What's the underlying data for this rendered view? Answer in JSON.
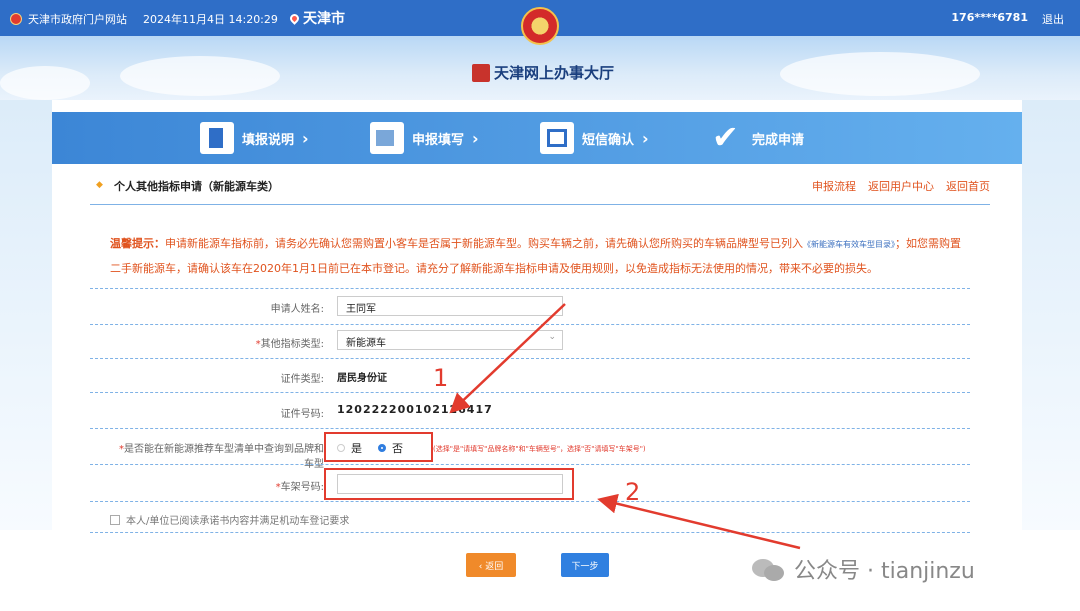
{
  "topbar": {
    "portal": "天津市政府门户网站",
    "datetime": "2024年11月4日 14:20:29",
    "city": "天津市",
    "phone": "176****6781",
    "logout": "退出"
  },
  "banner": {
    "title": "天津网上办事大厅"
  },
  "steps": [
    {
      "label": "填报说明",
      "icon": "doc-icon"
    },
    {
      "label": "申报填写",
      "icon": "pen-icon"
    },
    {
      "label": "短信确认",
      "icon": "phone-icon"
    },
    {
      "label": "完成申请",
      "icon": "check-icon"
    }
  ],
  "page": {
    "title": "个人其他指标申请（新能源车类）",
    "links": [
      "申报流程",
      "返回用户中心",
      "返回首页"
    ]
  },
  "notice": {
    "label": "温馨提示：",
    "text1": "申请新能源车指标前，请务必先确认您需购置小客车是否属于新能源车型。购买车辆之前，请先确认您所购买的车辆品牌型号已列入",
    "link": "《新能源车有效车型目录》",
    "text2": "；如您需购置二手新能源车，请确认该车在2020年1月1日前已在本市登记。请充分了解新能源车指标申请及使用规则，以免造成指标无法使用的情况，带来不必要的损失。"
  },
  "form": {
    "name_label": "申请人姓名:",
    "name_value": "王同军",
    "type_label": "其他指标类型:",
    "type_value": "新能源车",
    "id_type_label": "证件类型:",
    "id_type_value": "居民身份证",
    "id_no_label": "证件号码:",
    "id_no_value": "120222200102126417",
    "query_label": "是否能在新能源推荐车型清单中查询到品牌和车型",
    "radio_yes": "是",
    "radio_no": "否",
    "radio_selected": "否",
    "hint": "(选择\"是\"请填写\"品牌名称\"和\"车辆型号\"，选择\"否\"请填写\"车架号\")",
    "vin_label": "车架号码:",
    "vin_value": "",
    "agree_label": "本人/单位已阅读承诺书内容并满足机动车登记要求"
  },
  "buttons": {
    "back": "‹ 返回",
    "next": "下一步"
  },
  "annotations": {
    "one": "1",
    "two": "2",
    "color": "#e23b2e"
  },
  "watermark": "公众号 · tianjinzu"
}
